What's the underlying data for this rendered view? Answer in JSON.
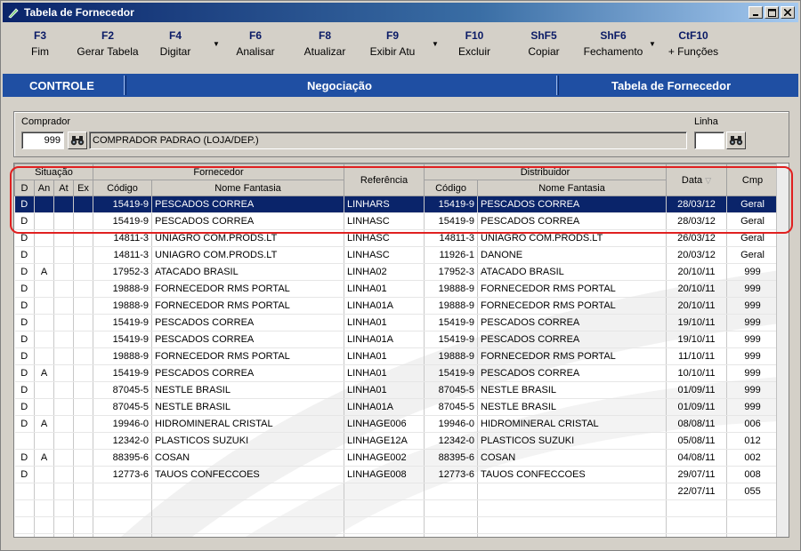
{
  "window": {
    "title": "Tabela de Fornecedor"
  },
  "toolbar": [
    {
      "key": "F3",
      "label": "Fim"
    },
    {
      "key": "F2",
      "label": "Gerar Tabela"
    },
    {
      "key": "F4",
      "label": "Digitar",
      "dropdown": true
    },
    {
      "key": "F6",
      "label": "Analisar"
    },
    {
      "key": "F8",
      "label": "Atualizar"
    },
    {
      "key": "F9",
      "label": "Exibir Atu",
      "dropdown": true
    },
    {
      "key": "F10",
      "label": "Excluir"
    },
    {
      "key": "ShF5",
      "label": "Copiar"
    },
    {
      "key": "ShF6",
      "label": "Fechamento",
      "dropdown": true
    },
    {
      "key": "CtF10",
      "label": "+ Funções"
    }
  ],
  "tabs": {
    "controle": "CONTROLE",
    "negociacao": "Negociação",
    "tabela": "Tabela de Fornecedor"
  },
  "filter": {
    "comprador_label": "Comprador",
    "comprador_code": "999",
    "comprador_name": "COMPRADOR PADRAO (LOJA/DEP.)",
    "linha_label": "Linha",
    "linha_value": ""
  },
  "grid": {
    "group_headers": {
      "situacao": "Situação",
      "fornecedor": "Fornecedor",
      "referencia": "Referência",
      "distribuidor": "Distribuidor",
      "data": "Data",
      "cmp": "Cmp"
    },
    "columns": [
      "D",
      "An",
      "At",
      "Ex",
      "Código",
      "Nome Fantasia",
      "Código",
      "Nome Fantasia"
    ],
    "rows": [
      [
        "D",
        "",
        "",
        "",
        "15419-9",
        "PESCADOS CORREA",
        "LINHARS",
        "15419-9",
        "PESCADOS CORREA",
        "28/03/12",
        "Geral"
      ],
      [
        "D",
        "",
        "",
        "",
        "15419-9",
        "PESCADOS CORREA",
        "LINHASC",
        "15419-9",
        "PESCADOS CORREA",
        "28/03/12",
        "Geral"
      ],
      [
        "D",
        "",
        "",
        "",
        "14811-3",
        "UNIAGRO COM.PRODS.LT",
        "LINHASC",
        "14811-3",
        "UNIAGRO COM.PRODS.LT",
        "26/03/12",
        "Geral"
      ],
      [
        "D",
        "",
        "",
        "",
        "14811-3",
        "UNIAGRO COM.PRODS.LT",
        "LINHASC",
        "11926-1",
        "DANONE",
        "20/03/12",
        "Geral"
      ],
      [
        "D",
        "A",
        "",
        "",
        "17952-3",
        "ATACADO BRASIL",
        "LINHA02",
        "17952-3",
        "ATACADO BRASIL",
        "20/10/11",
        "999"
      ],
      [
        "D",
        "",
        "",
        "",
        "19888-9",
        "FORNECEDOR RMS PORTAL",
        "LINHA01",
        "19888-9",
        "FORNECEDOR RMS PORTAL",
        "20/10/11",
        "999"
      ],
      [
        "D",
        "",
        "",
        "",
        "19888-9",
        "FORNECEDOR RMS PORTAL",
        "LINHA01A",
        "19888-9",
        "FORNECEDOR RMS PORTAL",
        "20/10/11",
        "999"
      ],
      [
        "D",
        "",
        "",
        "",
        "15419-9",
        "PESCADOS CORREA",
        "LINHA01",
        "15419-9",
        "PESCADOS CORREA",
        "19/10/11",
        "999"
      ],
      [
        "D",
        "",
        "",
        "",
        "15419-9",
        "PESCADOS CORREA",
        "LINHA01A",
        "15419-9",
        "PESCADOS CORREA",
        "19/10/11",
        "999"
      ],
      [
        "D",
        "",
        "",
        "",
        "19888-9",
        "FORNECEDOR RMS PORTAL",
        "LINHA01",
        "19888-9",
        "FORNECEDOR RMS PORTAL",
        "11/10/11",
        "999"
      ],
      [
        "D",
        "A",
        "",
        "",
        "15419-9",
        "PESCADOS CORREA",
        "LINHA01",
        "15419-9",
        "PESCADOS CORREA",
        "10/10/11",
        "999"
      ],
      [
        "D",
        "",
        "",
        "",
        "87045-5",
        "NESTLE BRASIL",
        "LINHA01",
        "87045-5",
        "NESTLE BRASIL",
        "01/09/11",
        "999"
      ],
      [
        "D",
        "",
        "",
        "",
        "87045-5",
        "NESTLE BRASIL",
        "LINHA01A",
        "87045-5",
        "NESTLE BRASIL",
        "01/09/11",
        "999"
      ],
      [
        "D",
        "A",
        "",
        "",
        "19946-0",
        "HIDROMINERAL CRISTAL",
        "LINHAGE006",
        "19946-0",
        "HIDROMINERAL CRISTAL",
        "08/08/11",
        "006"
      ],
      [
        "",
        "",
        "",
        "",
        "12342-0",
        "PLASTICOS SUZUKI",
        "LINHAGE12A",
        "12342-0",
        "PLASTICOS SUZUKI",
        "05/08/11",
        "012"
      ],
      [
        "D",
        "A",
        "",
        "",
        "88395-6",
        "COSAN",
        "LINHAGE002",
        "88395-6",
        "COSAN",
        "04/08/11",
        "002"
      ],
      [
        "D",
        "",
        "",
        "",
        "12773-6",
        "TAUOS CONFECCOES",
        "LINHAGE008",
        "12773-6",
        "TAUOS CONFECCOES",
        "29/07/11",
        "008"
      ],
      [
        "",
        "",
        "",
        "",
        "",
        "",
        "",
        "",
        "",
        "22/07/11",
        "055"
      ]
    ],
    "empty_rows": 3
  }
}
